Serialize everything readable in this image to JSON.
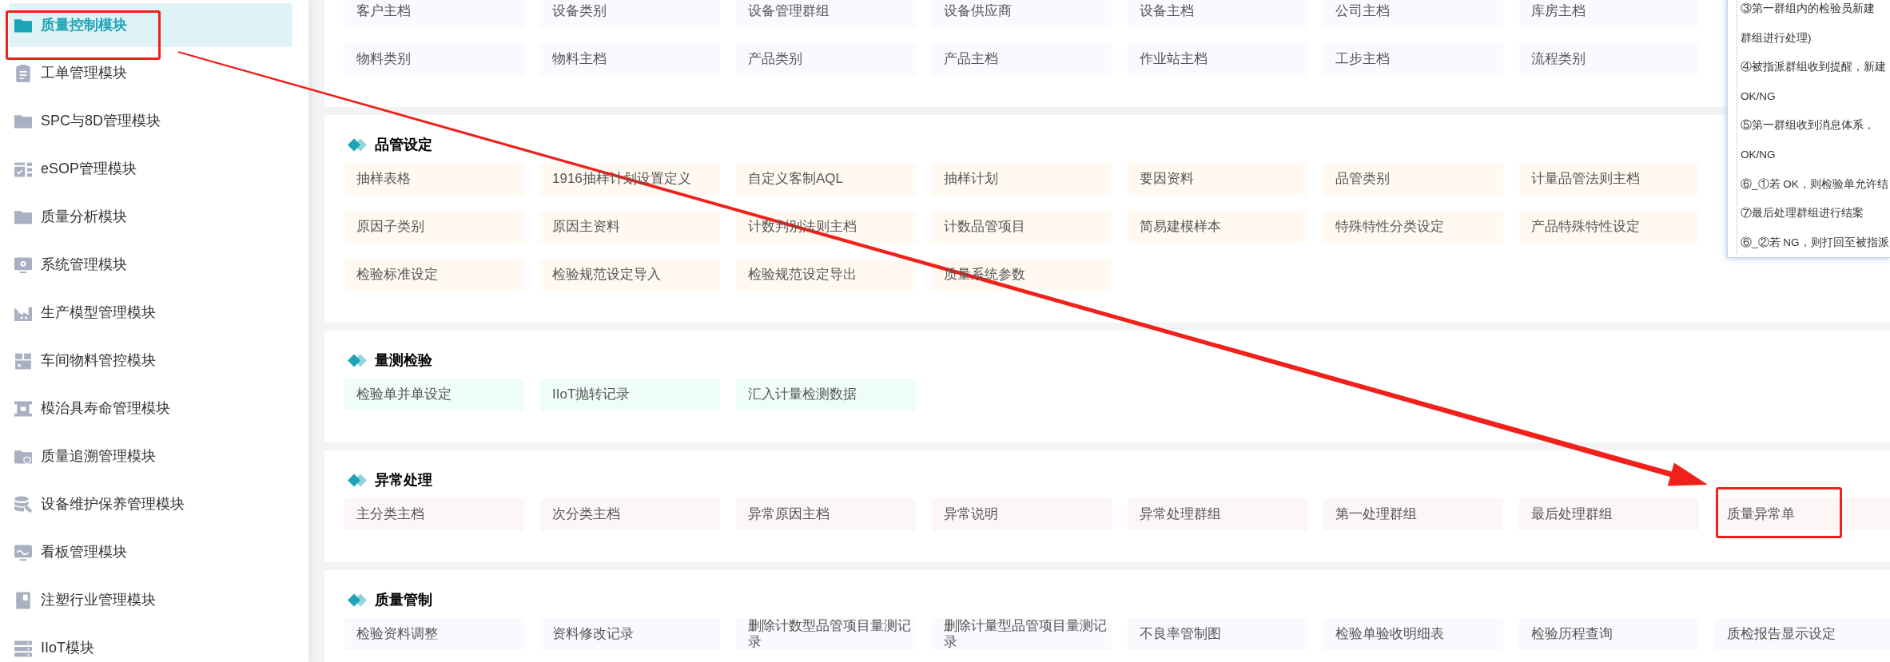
{
  "sidebar": {
    "items": [
      {
        "label": "质量控制模块",
        "selected": true,
        "highlighted": true
      },
      {
        "label": "工单管理模块",
        "selected": false,
        "highlighted": false
      },
      {
        "label": "SPC与8D管理模块",
        "selected": false,
        "highlighted": false
      },
      {
        "label": "eSOP管理模块",
        "selected": false,
        "highlighted": false
      },
      {
        "label": "质量分析模块",
        "selected": false,
        "highlighted": false
      },
      {
        "label": "系统管理模块",
        "selected": false,
        "highlighted": false
      },
      {
        "label": "生产模型管理模块",
        "selected": false,
        "highlighted": false
      },
      {
        "label": "车间物料管控模块",
        "selected": false,
        "highlighted": false
      },
      {
        "label": "模治具寿命管理模块",
        "selected": false,
        "highlighted": false
      },
      {
        "label": "质量追溯管理模块",
        "selected": false,
        "highlighted": false
      },
      {
        "label": "设备维护保养管理模块",
        "selected": false,
        "highlighted": false
      },
      {
        "label": "看板管理模块",
        "selected": false,
        "highlighted": false
      },
      {
        "label": "注塑行业管理模块",
        "selected": false,
        "highlighted": false
      },
      {
        "label": "IIoT模块",
        "selected": false,
        "highlighted": false
      }
    ]
  },
  "sections": [
    {
      "color": "#f9f9ff",
      "rows": [
        [
          {
            "label": "客户主档",
            "highlighted": false
          },
          {
            "label": "设备类别",
            "highlighted": false
          },
          {
            "label": "设备管理群组",
            "highlighted": false
          },
          {
            "label": "设备供应商",
            "highlighted": false
          },
          {
            "label": "设备主档",
            "highlighted": false
          },
          {
            "label": "公司主档",
            "highlighted": false
          },
          {
            "label": "库房主档",
            "highlighted": false
          }
        ],
        [
          {
            "label": "物料类别",
            "highlighted": false
          },
          {
            "label": "物料主档",
            "highlighted": false
          },
          {
            "label": "产品类别",
            "highlighted": false
          },
          {
            "label": "产品主档",
            "highlighted": false
          },
          {
            "label": "作业站主档",
            "highlighted": false
          },
          {
            "label": "工步主档",
            "highlighted": false
          },
          {
            "label": "流程类别",
            "highlighted": false
          }
        ]
      ]
    },
    {
      "title": "品管设定",
      "color": "#fff9f2",
      "rows": [
        [
          {
            "label": "抽样表格",
            "highlighted": false
          },
          {
            "label": "1916抽样计划设置定义",
            "highlighted": false
          },
          {
            "label": "自定义客制AQL",
            "highlighted": false
          },
          {
            "label": "抽样计划",
            "highlighted": false
          },
          {
            "label": "要因资料",
            "highlighted": false
          },
          {
            "label": "品管类别",
            "highlighted": false
          },
          {
            "label": "计量品管法则主档",
            "highlighted": false
          }
        ],
        [
          {
            "label": "原因子类别",
            "highlighted": false
          },
          {
            "label": "原因主资料",
            "highlighted": false
          },
          {
            "label": "计数判别法则主档",
            "highlighted": false
          },
          {
            "label": "计数品管项目",
            "highlighted": false
          },
          {
            "label": "简易建模样本",
            "highlighted": false
          },
          {
            "label": "特殊特性分类设定",
            "highlighted": false
          },
          {
            "label": "产品特殊特性设定",
            "highlighted": false
          }
        ],
        [
          {
            "label": "检验标准设定",
            "highlighted": false
          },
          {
            "label": "检验规范设定导入",
            "highlighted": false
          },
          {
            "label": "检验规范设定导出",
            "highlighted": false
          },
          {
            "label": "质量系统参数",
            "highlighted": false
          }
        ]
      ]
    },
    {
      "title": "量测检验",
      "color": "#effdf8",
      "rows": [
        [
          {
            "label": "检验单并单设定",
            "highlighted": false
          },
          {
            "label": "IIoT抛转记录",
            "highlighted": false
          },
          {
            "label": "汇入计量检测数据",
            "highlighted": false
          }
        ]
      ]
    },
    {
      "title": "异常处理",
      "color": "#fdf6f6",
      "rows": [
        [
          {
            "label": "主分类主档",
            "highlighted": false
          },
          {
            "label": "次分类主档",
            "highlighted": false
          },
          {
            "label": "异常原因主档",
            "highlighted": false
          },
          {
            "label": "异常说明",
            "highlighted": false
          },
          {
            "label": "异常处理群组",
            "highlighted": false
          },
          {
            "label": "第一处理群组",
            "highlighted": false
          },
          {
            "label": "最后处理群组",
            "highlighted": false
          },
          {
            "label": "质量异常单",
            "highlighted": true
          }
        ]
      ]
    },
    {
      "title": "质量管制",
      "color": "#f9f9fe",
      "rows": [
        [
          {
            "label": "检验资料调整",
            "highlighted": false
          },
          {
            "label": "资料修改记录",
            "highlighted": false
          },
          {
            "label": "删除计数型品管项目量测记录",
            "highlighted": false
          },
          {
            "label": "删除计量型品管项目量测记录",
            "highlighted": false
          },
          {
            "label": "不良率管制图",
            "highlighted": false
          },
          {
            "label": "检验单验收明细表",
            "highlighted": false
          },
          {
            "label": "检验历程查询",
            "highlighted": false
          },
          {
            "label": "质检报告显示设定",
            "highlighted": false
          }
        ]
      ]
    }
  ],
  "note_popup": {
    "lines": [
      "③第一群组内的检验员新建",
      "群组进行处理)",
      "④被指派群组收到提醒，新建",
      "OK/NG",
      "⑤第一群组收到消息体系，",
      "OK/NG",
      "⑥_①若 OK，则检验单允许结",
      "⑦最后处理群组进行结案",
      "⑥_②若 NG，则打回至被指派"
    ]
  },
  "annotations": {
    "arrow": true
  }
}
